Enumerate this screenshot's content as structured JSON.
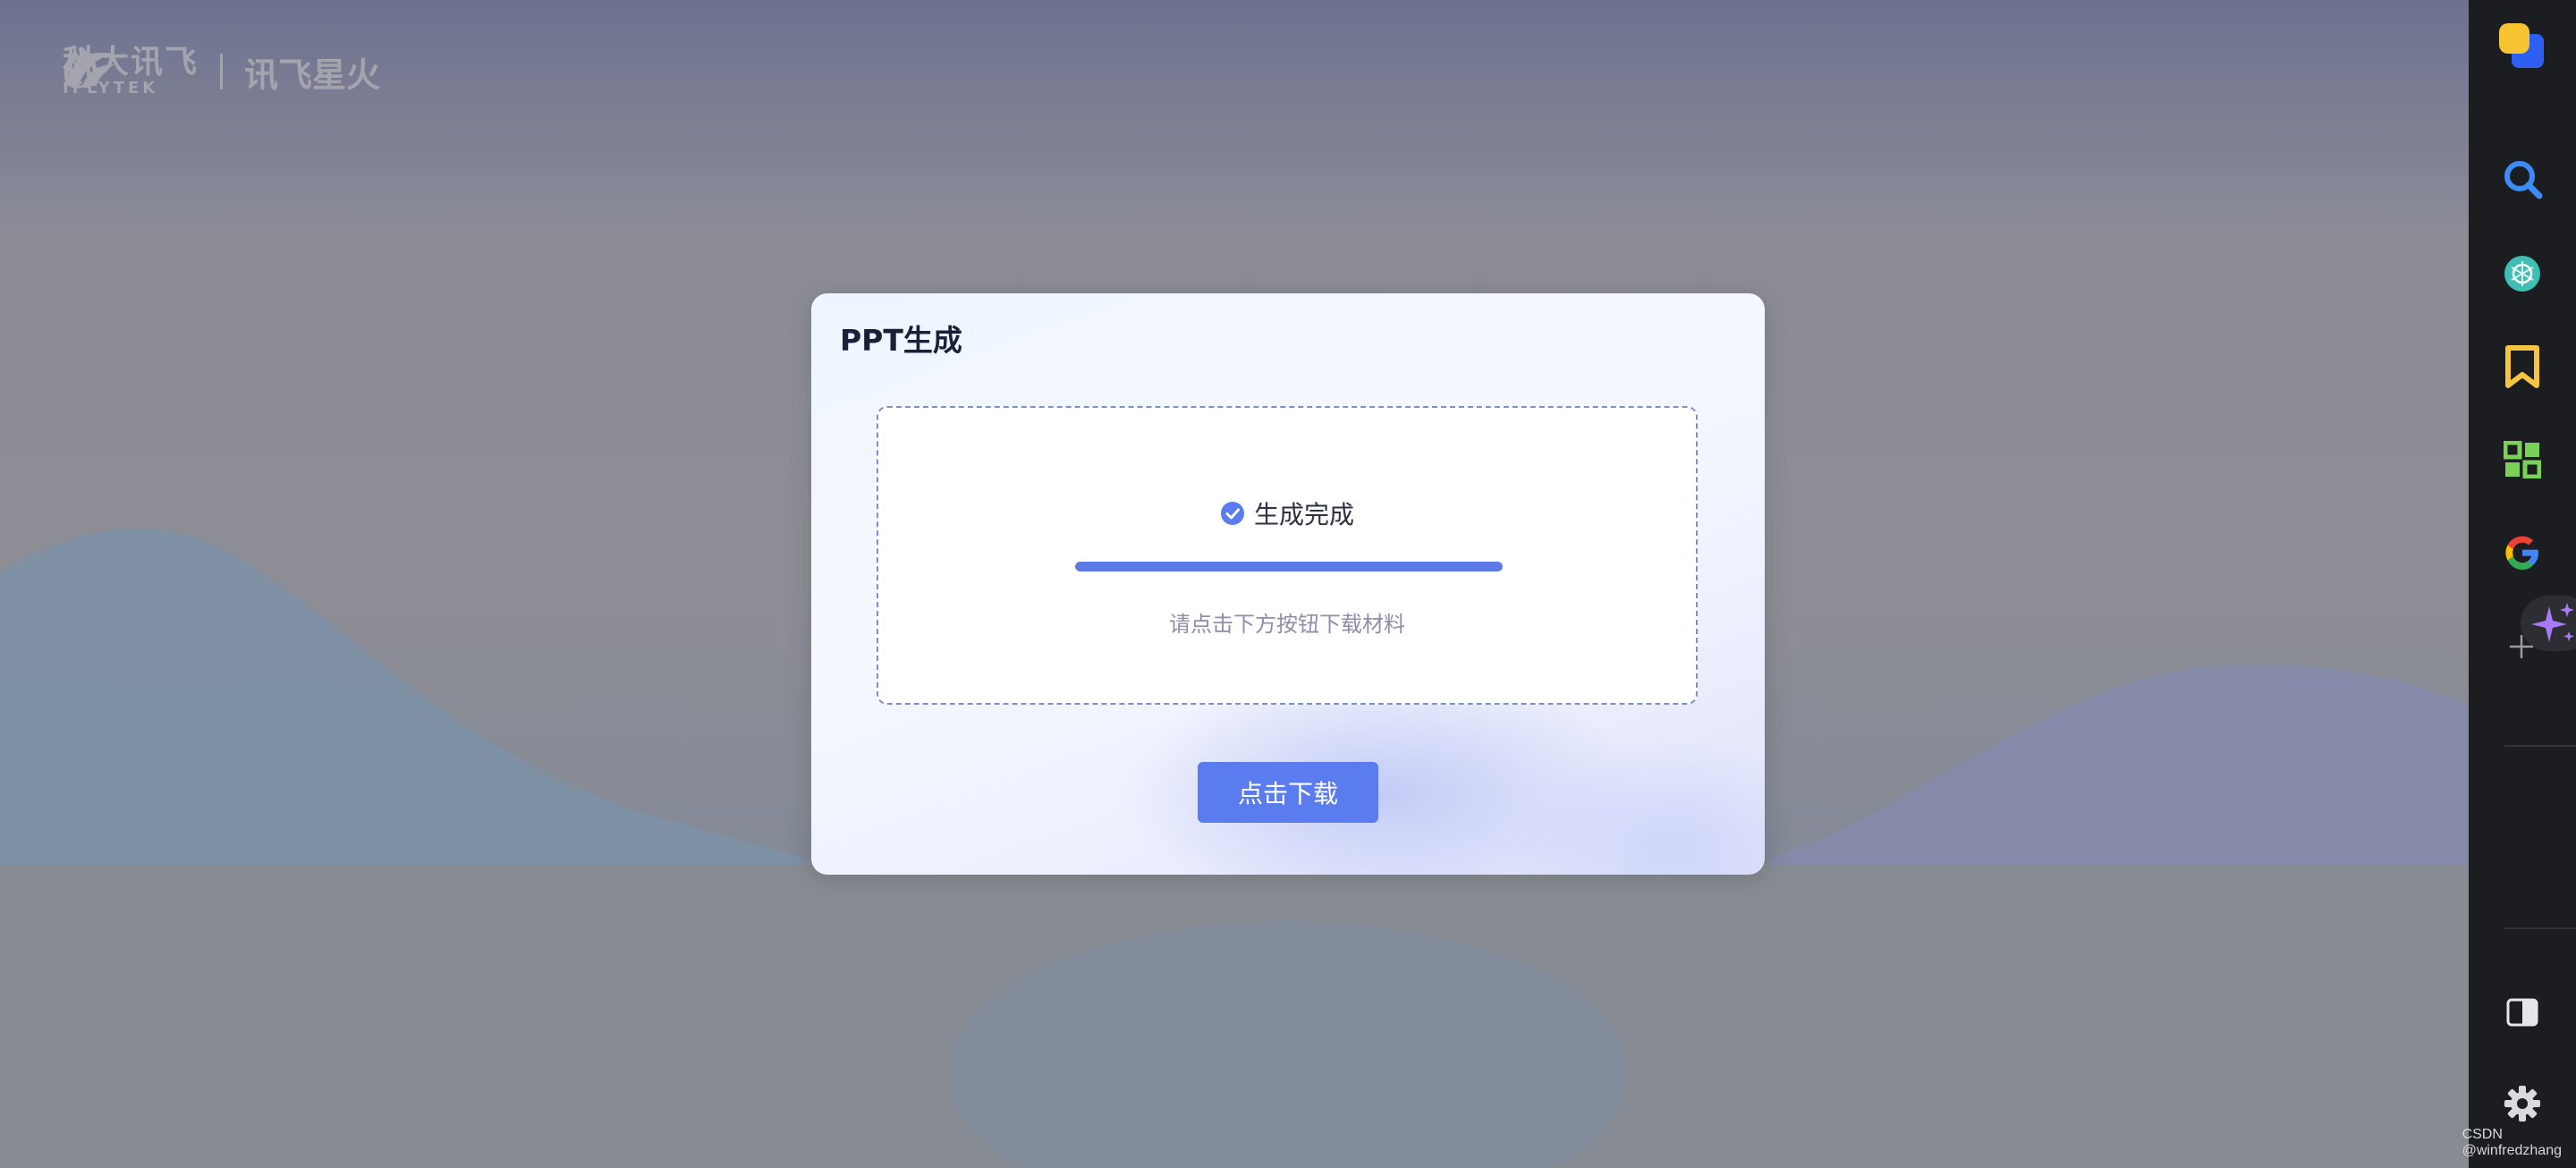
{
  "brand": {
    "logo1_cn": "科大讯飞",
    "logo1_en": "IFLYTEK",
    "logo2_cn": "讯飞星火"
  },
  "modal": {
    "title": "PPT生成",
    "status_text": "生成完成",
    "progress_percent": 100,
    "hint": "请点击下方按钮下载材料",
    "download_label": "点击下载"
  },
  "sidebar": {
    "items": [
      {
        "name": "app-logo-icon"
      },
      {
        "name": "search-icon",
        "color": "#3d8bf5"
      },
      {
        "name": "openai-icon",
        "color": "#4fd1c5"
      },
      {
        "name": "bookmark-icon",
        "color": "#f5c542"
      },
      {
        "name": "apps-grid-icon",
        "color": "#7bd05a"
      },
      {
        "name": "google-icon"
      },
      {
        "name": "sparkle-icon",
        "color": "#a97af5"
      },
      {
        "name": "add-icon"
      },
      {
        "name": "sidebar-toggle-icon"
      },
      {
        "name": "settings-icon"
      }
    ]
  },
  "watermark": "CSDN @winfredzhang",
  "colors": {
    "accent": "#5a7cee",
    "progress": "#5b7ae6",
    "sidebar_bg": "#1c1d21"
  }
}
